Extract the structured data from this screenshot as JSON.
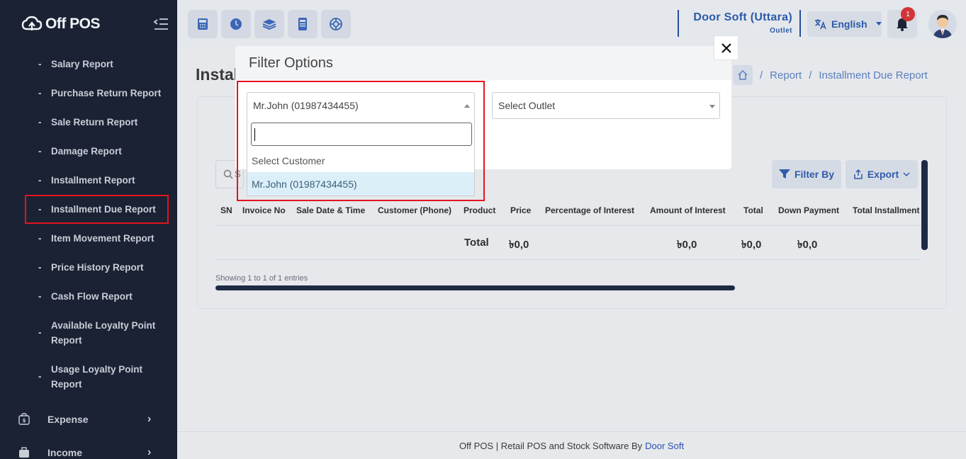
{
  "app": {
    "logo_text": "Off POS"
  },
  "sidebar": {
    "items": [
      {
        "label": "Salary Report"
      },
      {
        "label": "Purchase Return Report"
      },
      {
        "label": "Sale Return Report"
      },
      {
        "label": "Damage Report"
      },
      {
        "label": "Installment Report"
      },
      {
        "label": "Installment Due Report"
      },
      {
        "label": "Item Movement Report"
      },
      {
        "label": "Price History Report"
      },
      {
        "label": "Cash Flow Report"
      },
      {
        "label": "Available Loyalty Point Report"
      },
      {
        "label": "Usage Loyalty Point Report"
      }
    ],
    "sections": [
      {
        "label": "Expense",
        "chevron": "›"
      },
      {
        "label": "Income",
        "chevron": "›"
      }
    ],
    "dash": "-"
  },
  "topbar": {
    "quick_icons": [
      "calculator-icon",
      "clock-icon",
      "layers-icon",
      "register-icon",
      "support-icon"
    ],
    "outlet_name": "Door Soft (Uttara)",
    "outlet_label": "Outlet",
    "language": "English",
    "notification_count": "1"
  },
  "page": {
    "title": "Instal",
    "breadcrumb": [
      "Report",
      "Installment Due Report"
    ],
    "breadcrumb_sep": "/",
    "search_placeholder_letter": "S",
    "filter_label": "Filter By",
    "export_label": "Export",
    "table": {
      "columns": [
        "SN",
        "Invoice No",
        "Sale Date & Time",
        "Customer (Phone)",
        "Product",
        "Price",
        "Percentage of Interest",
        "Amount of Interest",
        "Total",
        "Down Payment",
        "Total Installment"
      ],
      "footer": {
        "label": "Total",
        "price": "৳0,0",
        "amount_of_interest": "৳0,0",
        "total": "৳0,0",
        "down_payment": "৳0,0"
      }
    },
    "showing": "Showing 1 to 1 of 1 entries"
  },
  "footer": {
    "text": "Off POS | Retail POS and Stock Software By",
    "link": "Door Soft"
  },
  "modal": {
    "title": "Filter Options",
    "close_label": "×",
    "customer_select": {
      "value": "Mr.John (01987434455)",
      "search_value": "",
      "options": [
        "Select Customer",
        "Mr.John (01987434455)"
      ]
    },
    "outlet_select": {
      "value": "Select Outlet"
    }
  },
  "colors": {
    "sidebar_bg": "#1a2234",
    "accent": "#2b5aa8",
    "highlight": "#e3141c",
    "selected_option": "#dbeff9"
  }
}
